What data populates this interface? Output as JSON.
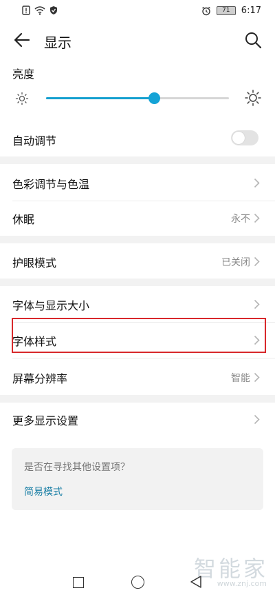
{
  "status_bar": {
    "time": "6:17",
    "battery": "71"
  },
  "header": {
    "title": "显示"
  },
  "brightness": {
    "label": "亮度",
    "level_fraction": 0.59,
    "auto_label": "自动调节",
    "auto_on": false
  },
  "rows": {
    "color": {
      "label": "色彩调节与色温"
    },
    "sleep": {
      "label": "休眠",
      "value": "永不"
    },
    "eye": {
      "label": "护眼模式",
      "value": "已关闭"
    },
    "font_size": {
      "label": "字体与显示大小"
    },
    "font_style": {
      "label": "字体样式"
    },
    "resolution": {
      "label": "屏幕分辨率",
      "value": "智能"
    },
    "more": {
      "label": "更多显示设置"
    }
  },
  "suggestion": {
    "question": "是否在寻找其他设置项？",
    "link": "简易模式"
  },
  "watermark": {
    "brand": "智能家",
    "url": "www.znj.com"
  },
  "colors": {
    "accent": "#149fcf",
    "highlight_box": "#d8282b",
    "link": "#1a7fa5"
  }
}
